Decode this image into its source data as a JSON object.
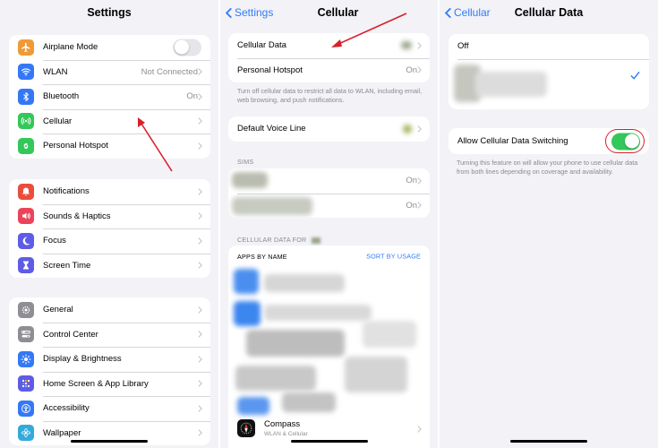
{
  "panel1": {
    "title": "Settings",
    "group1": [
      {
        "label": "Airplane Mode",
        "icon": "airplane-icon",
        "color": "#f09a37",
        "type": "toggle",
        "on": false
      },
      {
        "label": "WLAN",
        "icon": "wifi-icon",
        "color": "#3478f6",
        "value": "Not Connected"
      },
      {
        "label": "Bluetooth",
        "icon": "bluetooth-icon",
        "color": "#3478f6",
        "value": "On"
      },
      {
        "label": "Cellular",
        "icon": "cellular-icon",
        "color": "#34c759"
      },
      {
        "label": "Personal Hotspot",
        "icon": "hotspot-icon",
        "color": "#34c759"
      }
    ],
    "group2": [
      {
        "label": "Notifications",
        "icon": "bell-icon",
        "color": "#eb4d3d"
      },
      {
        "label": "Sounds & Haptics",
        "icon": "speaker-icon",
        "color": "#eb445a"
      },
      {
        "label": "Focus",
        "icon": "moon-icon",
        "color": "#5e5ce6"
      },
      {
        "label": "Screen Time",
        "icon": "hourglass-icon",
        "color": "#5e5ce6"
      }
    ],
    "group3": [
      {
        "label": "General",
        "icon": "gear-icon",
        "color": "#8e8e93"
      },
      {
        "label": "Control Center",
        "icon": "switches-icon",
        "color": "#8e8e93"
      },
      {
        "label": "Display & Brightness",
        "icon": "sun-icon",
        "color": "#3478f6"
      },
      {
        "label": "Home Screen & App Library",
        "icon": "grid-icon",
        "color": "#5e5ce6"
      },
      {
        "label": "Accessibility",
        "icon": "accessibility-icon",
        "color": "#3478f6"
      },
      {
        "label": "Wallpaper",
        "icon": "flower-icon",
        "color": "#34aadc"
      }
    ]
  },
  "panel2": {
    "back": "Settings",
    "title": "Cellular",
    "group1": [
      {
        "label": "Cellular Data"
      },
      {
        "label": "Personal Hotspot",
        "value": "On"
      }
    ],
    "footnote1": "Turn off cellular data to restrict all data to WLAN, including email, web browsing, and push notifications.",
    "voice": {
      "label": "Default Voice Line"
    },
    "sims_header": "SIMs",
    "sims": [
      {
        "value": "On"
      },
      {
        "value": "On"
      }
    ],
    "data_for_header": "CELLULAR DATA FOR",
    "apps_header": "APPS BY NAME",
    "sort_label": "SORT BY USAGE",
    "last_app": {
      "name": "Compass",
      "sub": "WLAN & Cellular"
    }
  },
  "panel3": {
    "back": "Cellular",
    "title": "Cellular Data",
    "options": [
      {
        "label": "Off"
      }
    ],
    "switching": {
      "label": "Allow Cellular Data Switching",
      "on": true
    },
    "footnote": "Turning this feature on will allow your phone to use cellular data from both lines depending on coverage and availability."
  },
  "colors": {
    "accent": "#2f7cf6",
    "toggle_on": "#34c759",
    "annotation": "#d8202a"
  }
}
